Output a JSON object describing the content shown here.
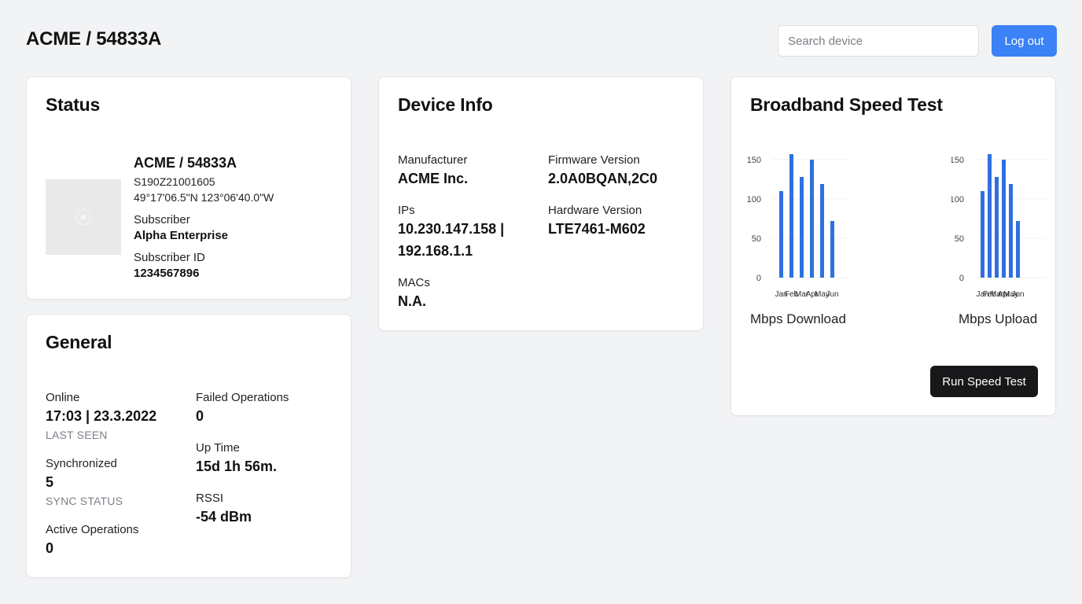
{
  "header": {
    "title": "ACME / 54833A",
    "search_placeholder": "Search device",
    "logout_label": "Log out"
  },
  "status": {
    "title": "Status",
    "device_name": "ACME / 54833A",
    "serial": "S190Z21001605",
    "coordinates": "49°17'06.5\"N 123°06'40.0\"W",
    "subscriber_label": "Subscriber",
    "subscriber_value": "Alpha Enterprise",
    "subscriber_id_label": "Subscriber ID",
    "subscriber_id_value": "1234567896"
  },
  "general": {
    "title": "General",
    "online_label": "Online",
    "online_value": "17:03 | 23.3.2022",
    "online_sub": "LAST SEEN",
    "sync_label": "Synchronized",
    "sync_value": "5",
    "sync_sub": "SYNC STATUS",
    "active_label": "Active Operations",
    "active_value": "0",
    "failed_label": "Failed Operations",
    "failed_value": "0",
    "uptime_label": "Up Time",
    "uptime_value": "15d 1h 56m.",
    "rssi_label": "RSSI",
    "rssi_value": "-54 dBm"
  },
  "device_info": {
    "title": "Device Info",
    "manufacturer_label": "Manufacturer",
    "manufacturer_value": "ACME Inc.",
    "firmware_label": "Firmware Version",
    "firmware_value": "2.0A0BQAN,2C0",
    "ips_label": "IPs",
    "ips_line1": "10.230.147.158 |",
    "ips_line2": "192.168.1.1",
    "hardware_label": "Hardware Version",
    "hardware_value": "LTE7461-M602",
    "macs_label": "MACs",
    "macs_value": "N.A."
  },
  "speed_test": {
    "title": "Broadband Speed Test",
    "run_label": "Run Speed Test",
    "bar_color": "#2f6fe0"
  },
  "chart_data": [
    {
      "type": "bar",
      "categories": [
        "Jan",
        "Feb",
        "Mar",
        "Apr",
        "May",
        "Jun"
      ],
      "values": [
        110,
        157,
        128,
        150,
        119,
        72
      ],
      "ylim": [
        0,
        160
      ],
      "yticks": [
        0,
        50,
        100,
        150
      ],
      "xlabel": "Mbps Download",
      "ylabel": "",
      "grid": true
    },
    {
      "type": "bar",
      "categories": [
        "Jan",
        "Feb",
        "Mar",
        "Apr",
        "May",
        "Jun"
      ],
      "values": [
        110,
        157,
        128,
        150,
        119,
        72
      ],
      "ylim": [
        0,
        160
      ],
      "yticks": [
        0,
        50,
        100,
        150
      ],
      "xlabel": "Mbps Upload",
      "ylabel": "",
      "grid": true
    }
  ]
}
